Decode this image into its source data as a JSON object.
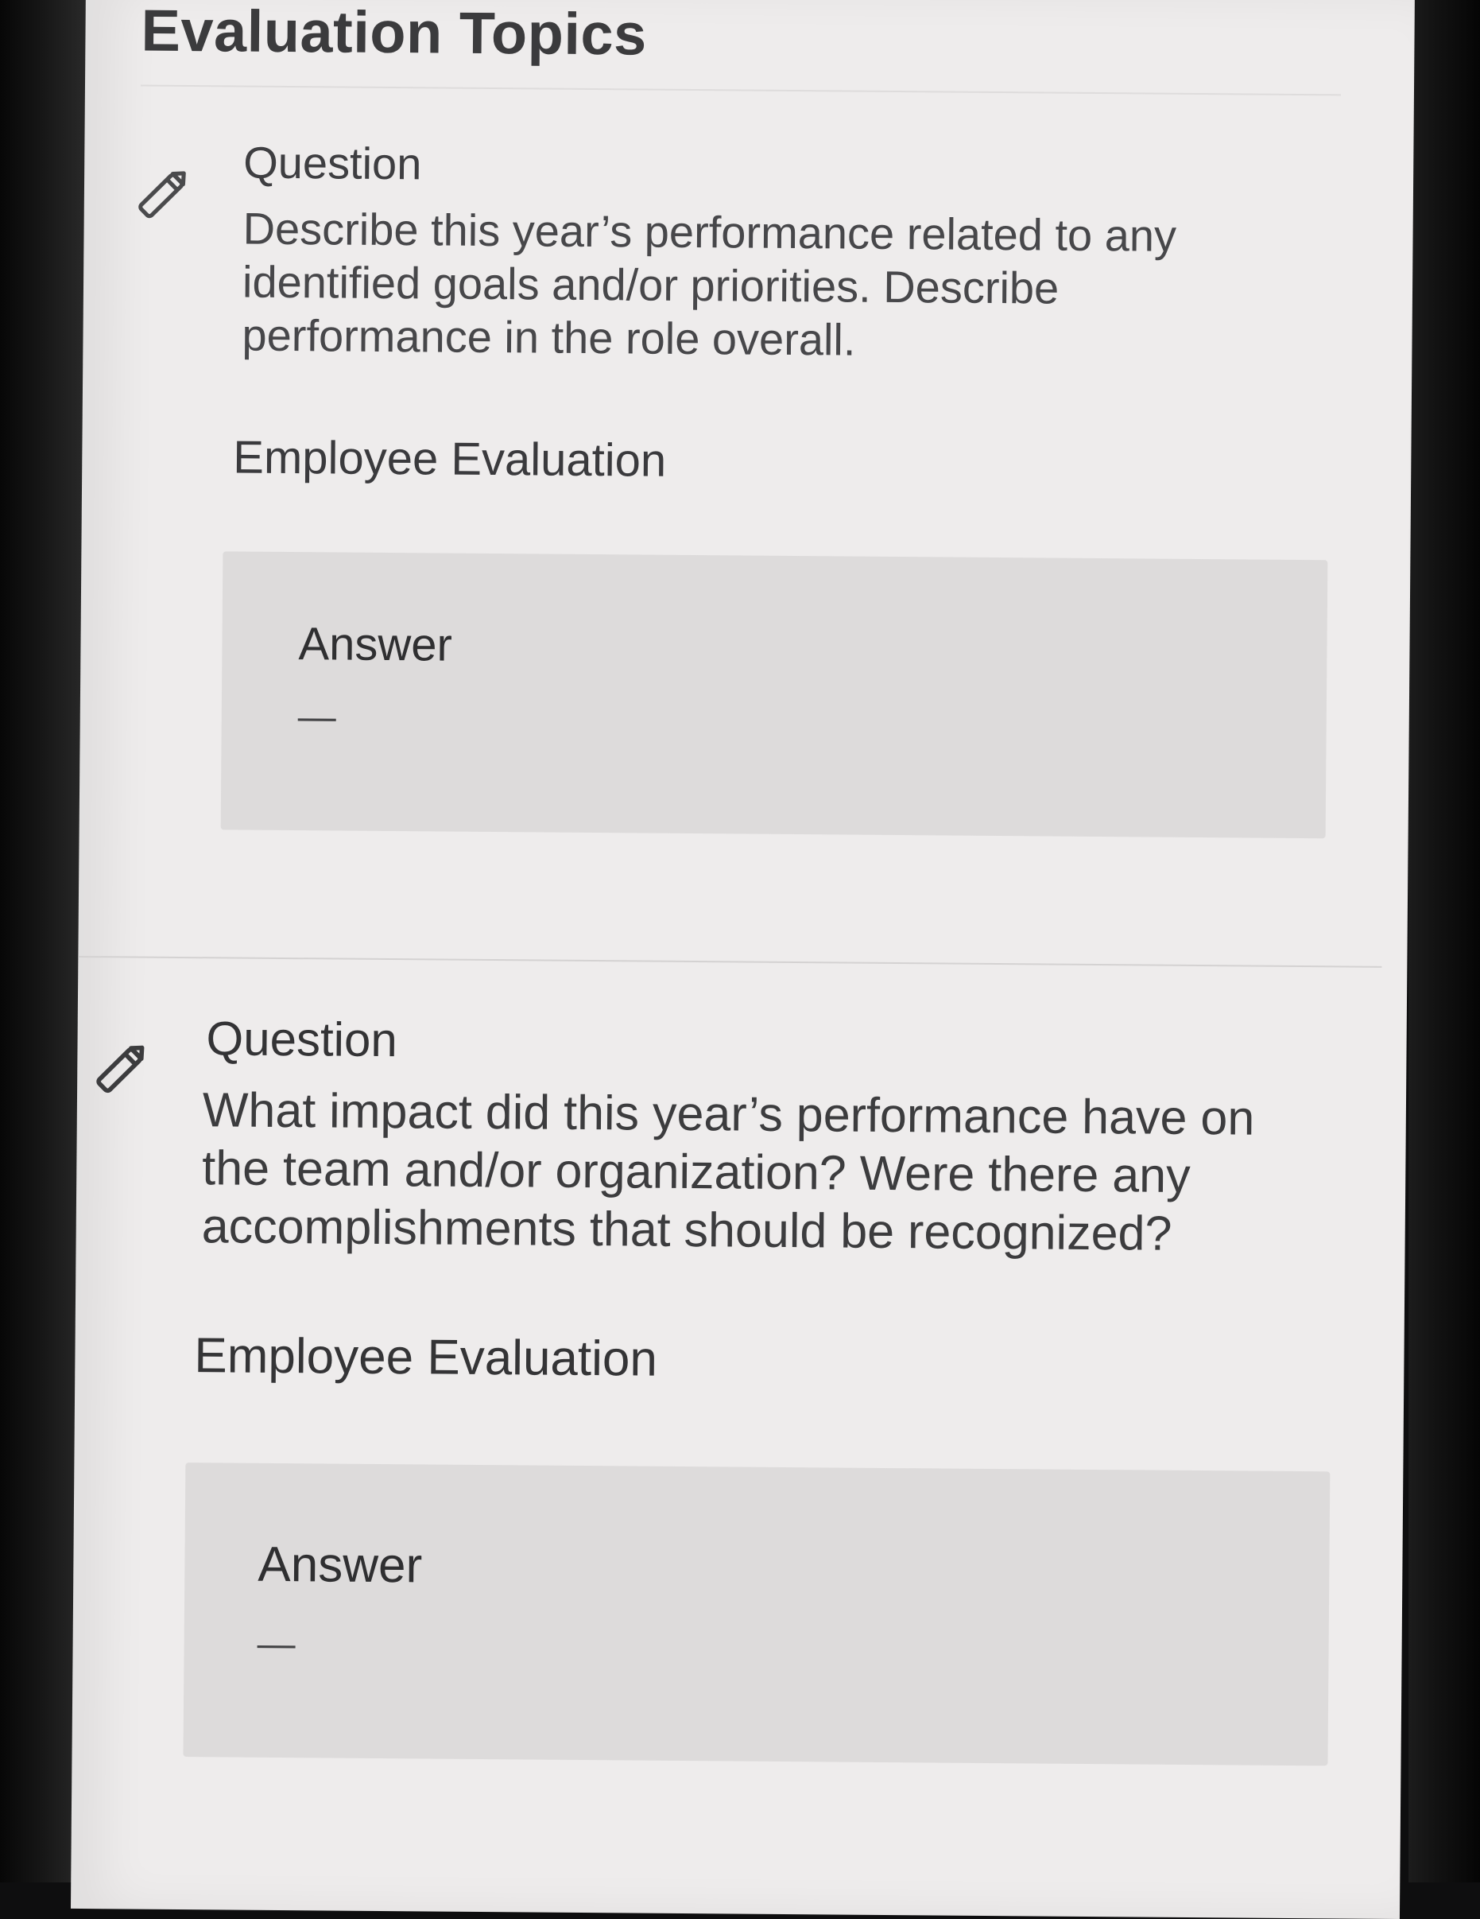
{
  "page": {
    "title": "Evaluation Topics"
  },
  "topics": [
    {
      "question_label": "Question",
      "question_text": "Describe this year’s performance related to any identified goals and/or priorities. Describe performance in the role overall.",
      "evaluation_label": "Employee Evaluation",
      "answer_label": "Answer",
      "answer_value": "—",
      "edit_icon": "pencil-icon"
    },
    {
      "question_label": "Question",
      "question_text": "What impact did this year’s performance have on the team and/or organization? Were there any accomplishments that should be recognized?",
      "evaluation_label": "Employee Evaluation",
      "answer_label": "Answer",
      "answer_value": "—",
      "edit_icon": "pencil-icon"
    }
  ],
  "colors": {
    "screen_background": "#eeecec",
    "answer_box": "#dddbdb",
    "text": "#3b3b3d"
  }
}
